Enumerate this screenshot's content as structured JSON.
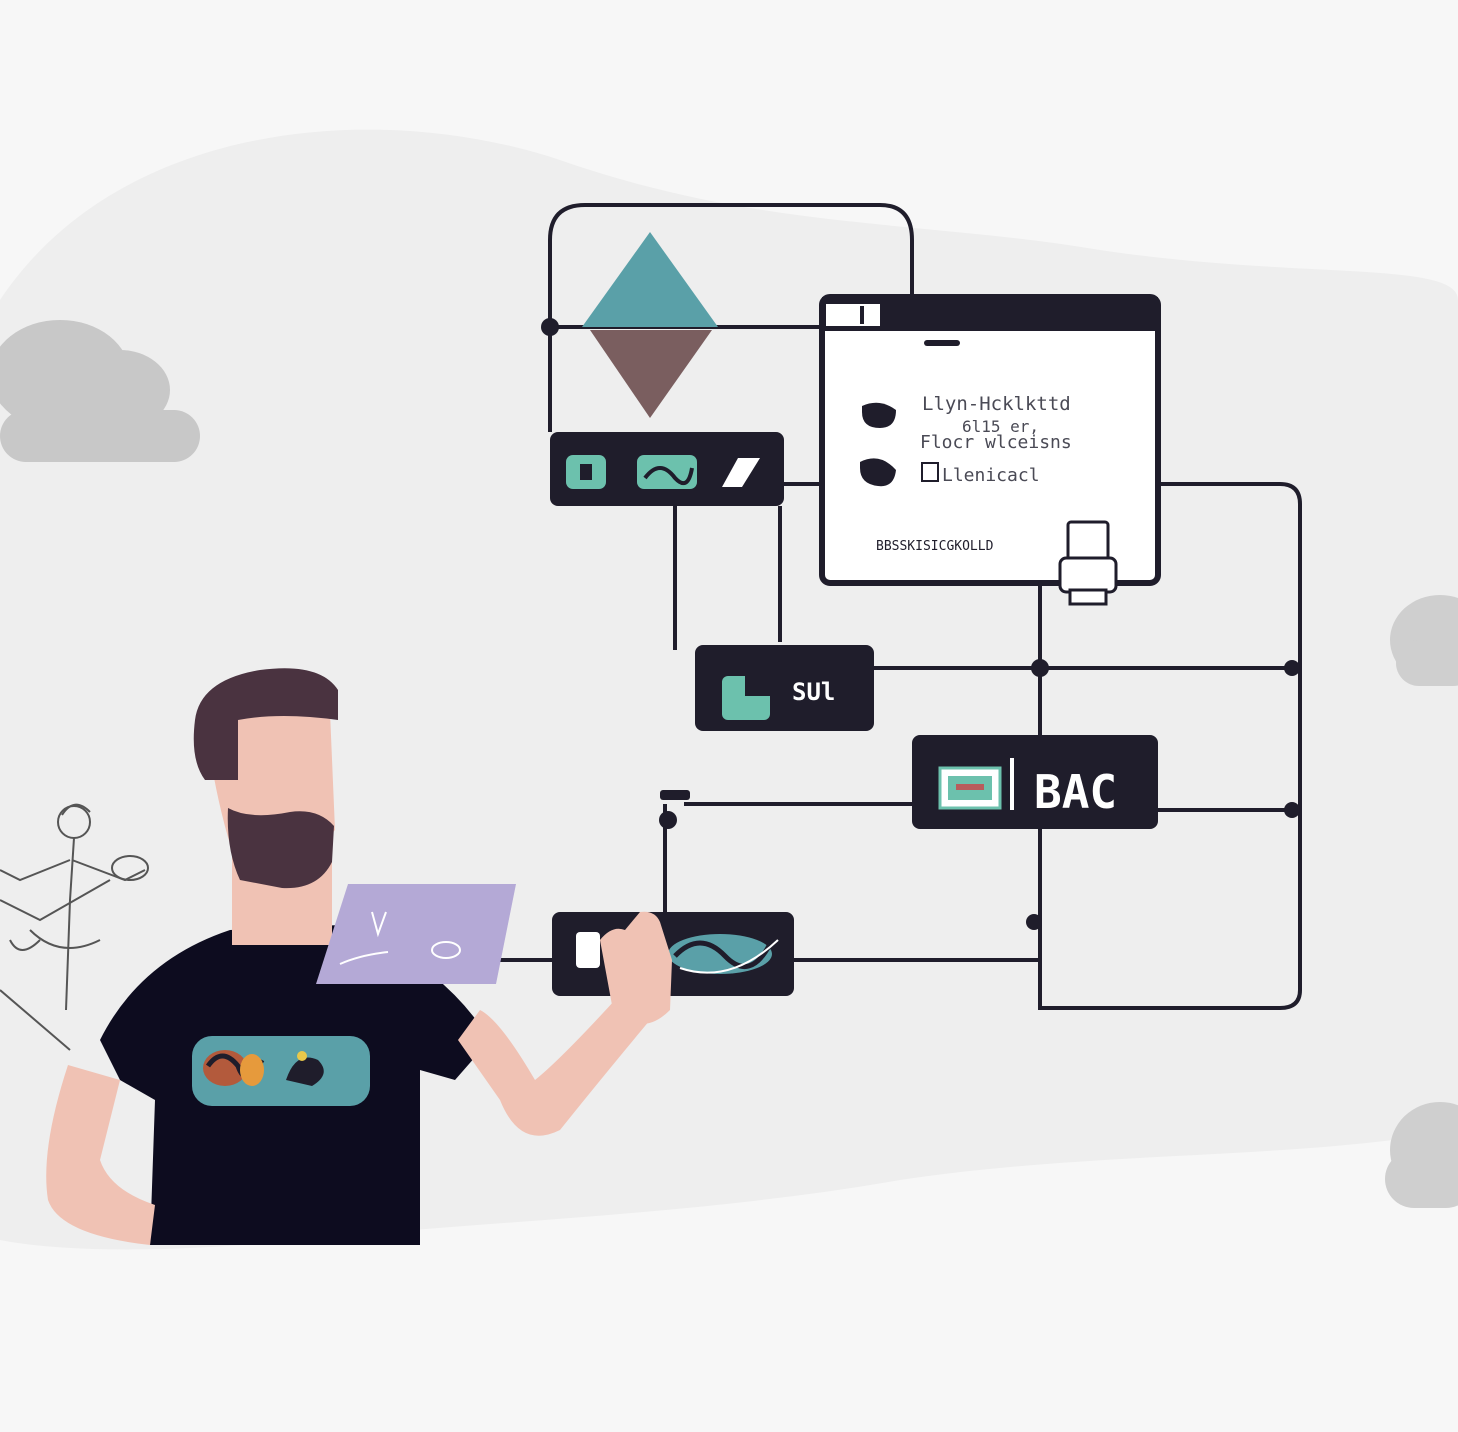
{
  "palette": {
    "background": "#f7f7f7",
    "blob": "#eeeeee",
    "ink": "#1f1d2b",
    "teal": "#5aa0a8",
    "mauve": "#7a5e5f",
    "mint": "#6cc1ad",
    "skin": "#f0c2b4",
    "hair": "#4a3340",
    "shirt": "#0d0c1f",
    "tablet": "#b4a9d6",
    "cloud": "#c8c8c8"
  },
  "illustration": {
    "window_panel": {
      "line1": "Llyn-Hcklkttd",
      "line2": "6l15  er,",
      "line3": "Flocr  wlceisns",
      "line4": "Llenicacl",
      "footer": "BBSSKISICGKOLLD"
    },
    "node_mid": {
      "label": "SUl"
    },
    "node_right": {
      "label": "BAC"
    }
  }
}
